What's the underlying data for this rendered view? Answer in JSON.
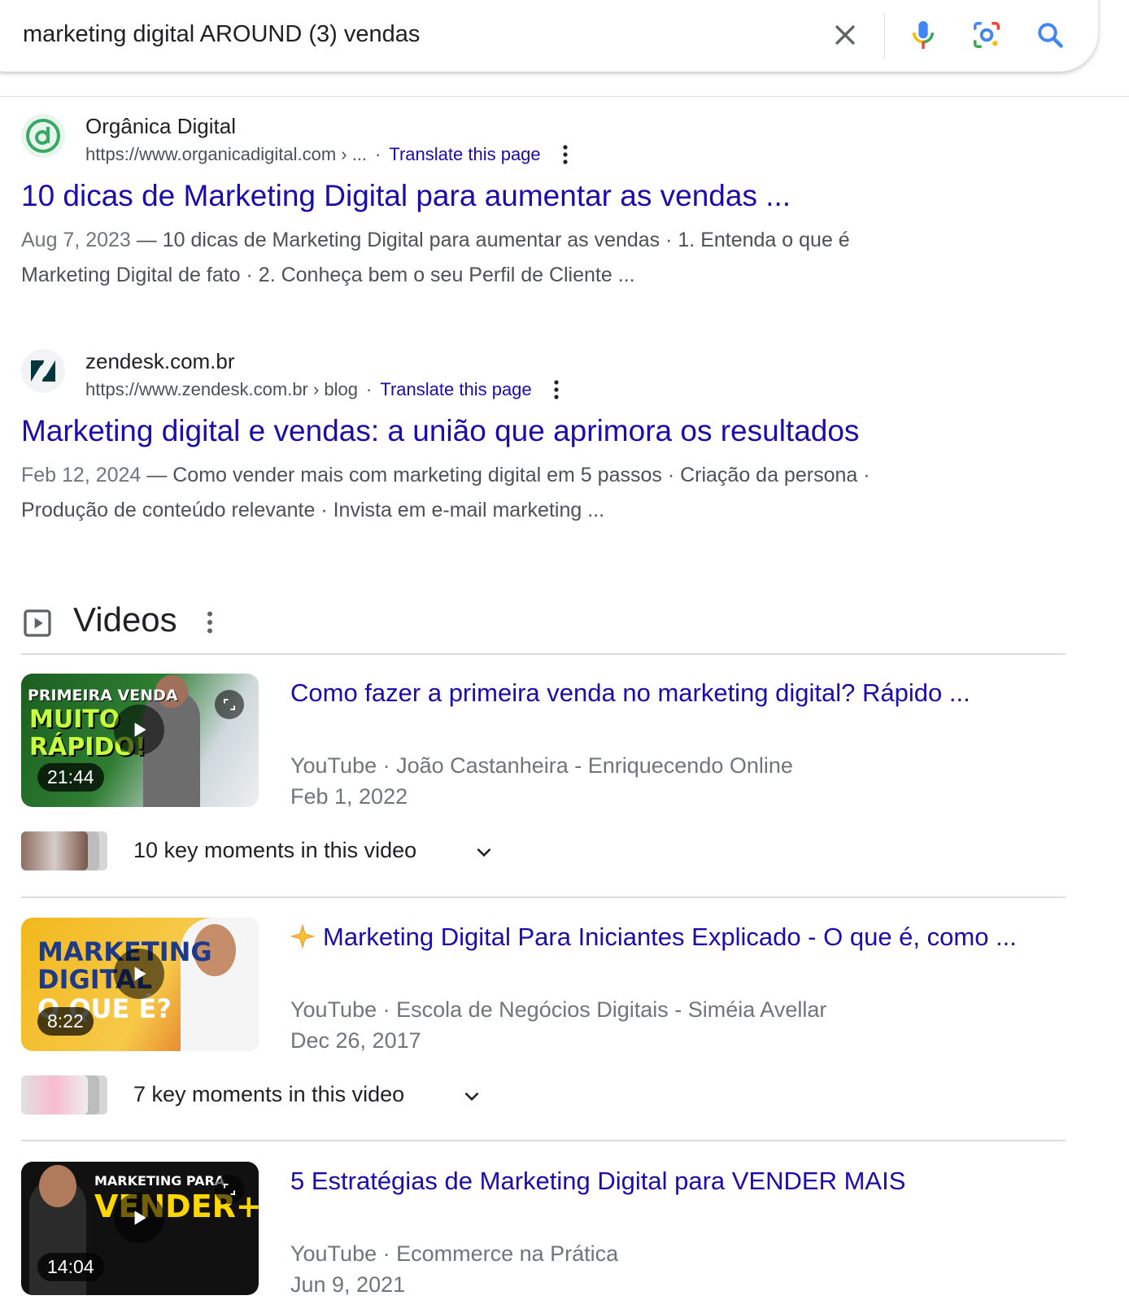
{
  "search": {
    "query": "marketing digital AROUND (3) vendas"
  },
  "results": [
    {
      "site_name": "Orgânica Digital",
      "url": "https://www.organicadigital.com › ...",
      "translate": "Translate this page",
      "title": "10 dicas de Marketing Digital para aumentar as vendas ...",
      "date": "Aug 7, 2023",
      "snippet_line1": " — 10 dicas de Marketing Digital para aumentar as vendas · 1. Entenda o que é",
      "snippet_line2": "Marketing Digital de fato · 2. Conheça bem o seu Perfil de Cliente ...",
      "favicon_color": "#3aa864"
    },
    {
      "site_name": "zendesk.com.br",
      "url": "https://www.zendesk.com.br › blog",
      "translate": "Translate this page",
      "title": "Marketing digital e vendas: a união que aprimora os resultados",
      "date": "Feb 12, 2024",
      "snippet_line1": " — Como vender mais com marketing digital em 5 passos · Criação da persona ·",
      "snippet_line2": "Produção de conteúdo relevante · Invista em e-mail marketing ...",
      "favicon_color": "#03363d"
    }
  ],
  "videos": {
    "heading": "Videos",
    "items": [
      {
        "title": "Como fazer a primeira venda no marketing digital? Rápido ...",
        "source": "YouTube · João Castanheira - Enriquecendo Online",
        "date": "Feb 1, 2022",
        "duration": "21:44",
        "thumb_text_1": "PRIMEIRA VENDA",
        "thumb_text_2": "MUITO",
        "thumb_text_3": "RÁPIDO!",
        "moments": "10 key moments in this video",
        "thumb_color": "#1b5e20"
      },
      {
        "title": "Marketing Digital Para Iniciantes Explicado - O que é, como ...",
        "source": "YouTube · Escola de Negócios Digitais - Siméia Avellar",
        "date": "Dec 26, 2017",
        "duration": "8:22",
        "thumb_text_1": "MARKETING",
        "thumb_text_2": "DIGITAL",
        "thumb_text_3": "O QUE É?",
        "moments": "7 key moments in this video",
        "thumb_color": "#f2b81d"
      },
      {
        "title": "5 Estratégias de Marketing Digital para VENDER MAIS",
        "source": "YouTube · Ecommerce na Prática",
        "date": "Jun 9, 2021",
        "duration": "14:04",
        "thumb_text_1": "MARKETING PARA",
        "thumb_text_2": "VENDER+",
        "thumb_color": "#111111"
      }
    ]
  }
}
